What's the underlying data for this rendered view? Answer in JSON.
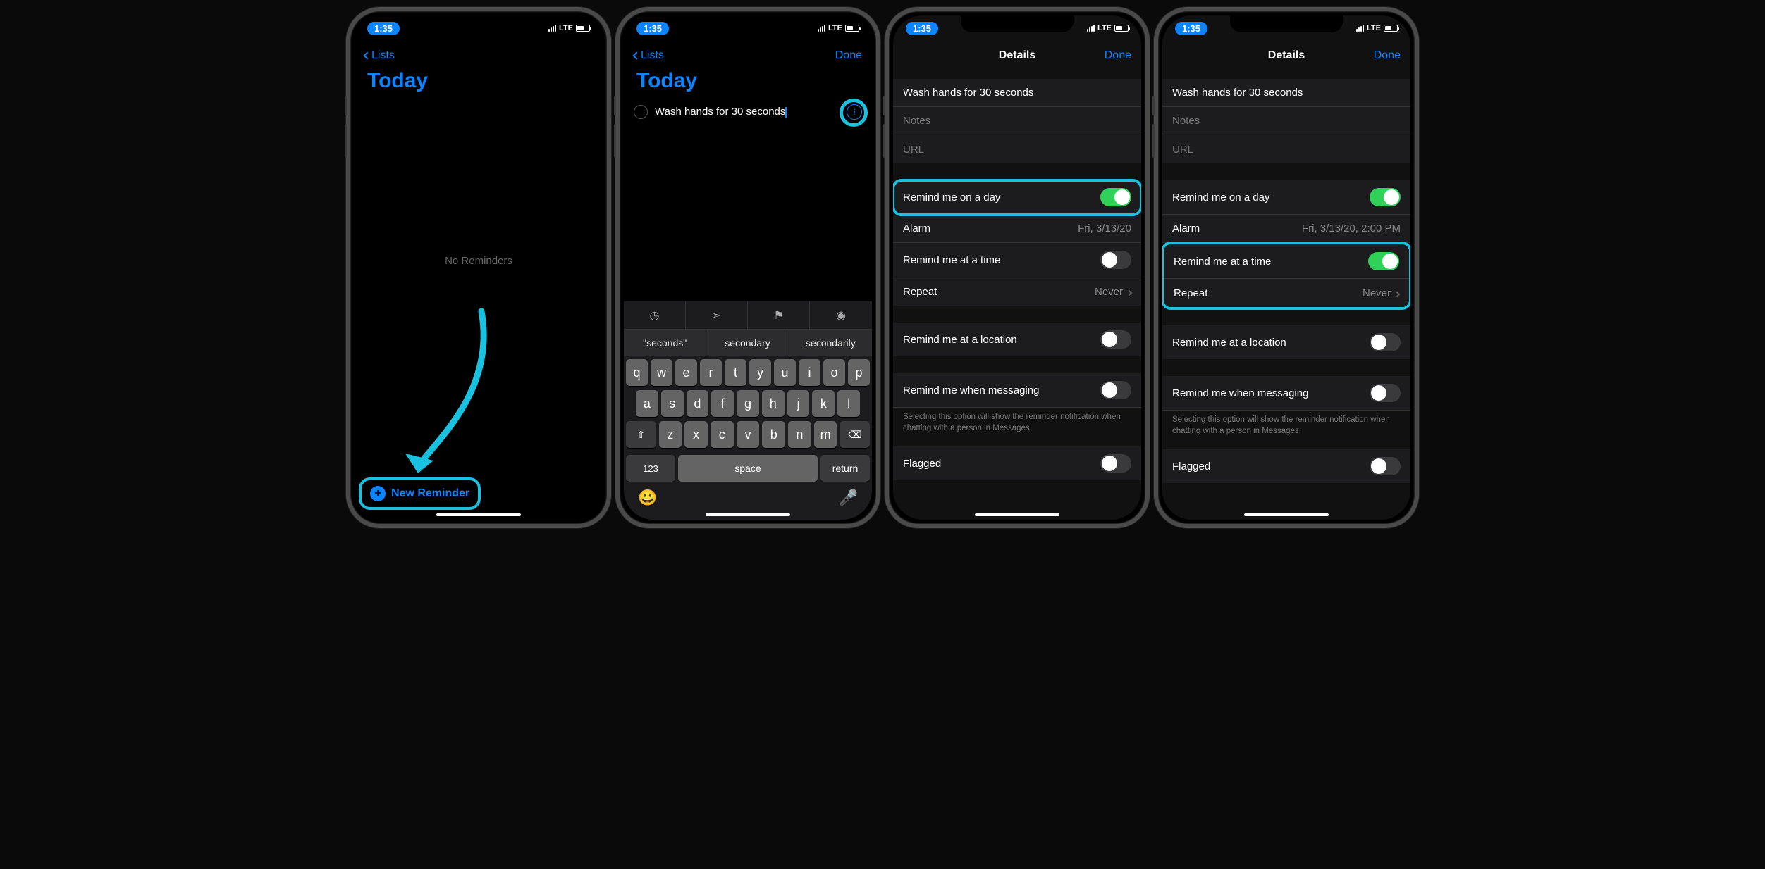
{
  "status": {
    "time": "1:35",
    "carrier": "LTE"
  },
  "screen1": {
    "back": "Lists",
    "title": "Today",
    "empty": "No Reminders",
    "new_btn": "New Reminder"
  },
  "screen2": {
    "back": "Lists",
    "done": "Done",
    "title": "Today",
    "reminder_text": "Wash hands for 30 seconds",
    "suggestions": [
      "\"seconds\"",
      "secondary",
      "secondarily"
    ],
    "kbd_123": "123",
    "kbd_space": "space",
    "kbd_return": "return"
  },
  "screen3": {
    "title": "Details",
    "done": "Done",
    "reminder_title": "Wash hands for 30 seconds",
    "notes_ph": "Notes",
    "url_ph": "URL",
    "remind_day": "Remind me on a day",
    "alarm_lbl": "Alarm",
    "alarm_val": "Fri, 3/13/20",
    "remind_time": "Remind me at a time",
    "repeat_lbl": "Repeat",
    "repeat_val": "Never",
    "remind_loc": "Remind me at a location",
    "remind_msg": "Remind me when messaging",
    "msg_note": "Selecting this option will show the reminder notification when chatting with a person in Messages.",
    "flagged": "Flagged"
  },
  "screen4": {
    "alarm_val": "Fri, 3/13/20, 2:00 PM"
  }
}
